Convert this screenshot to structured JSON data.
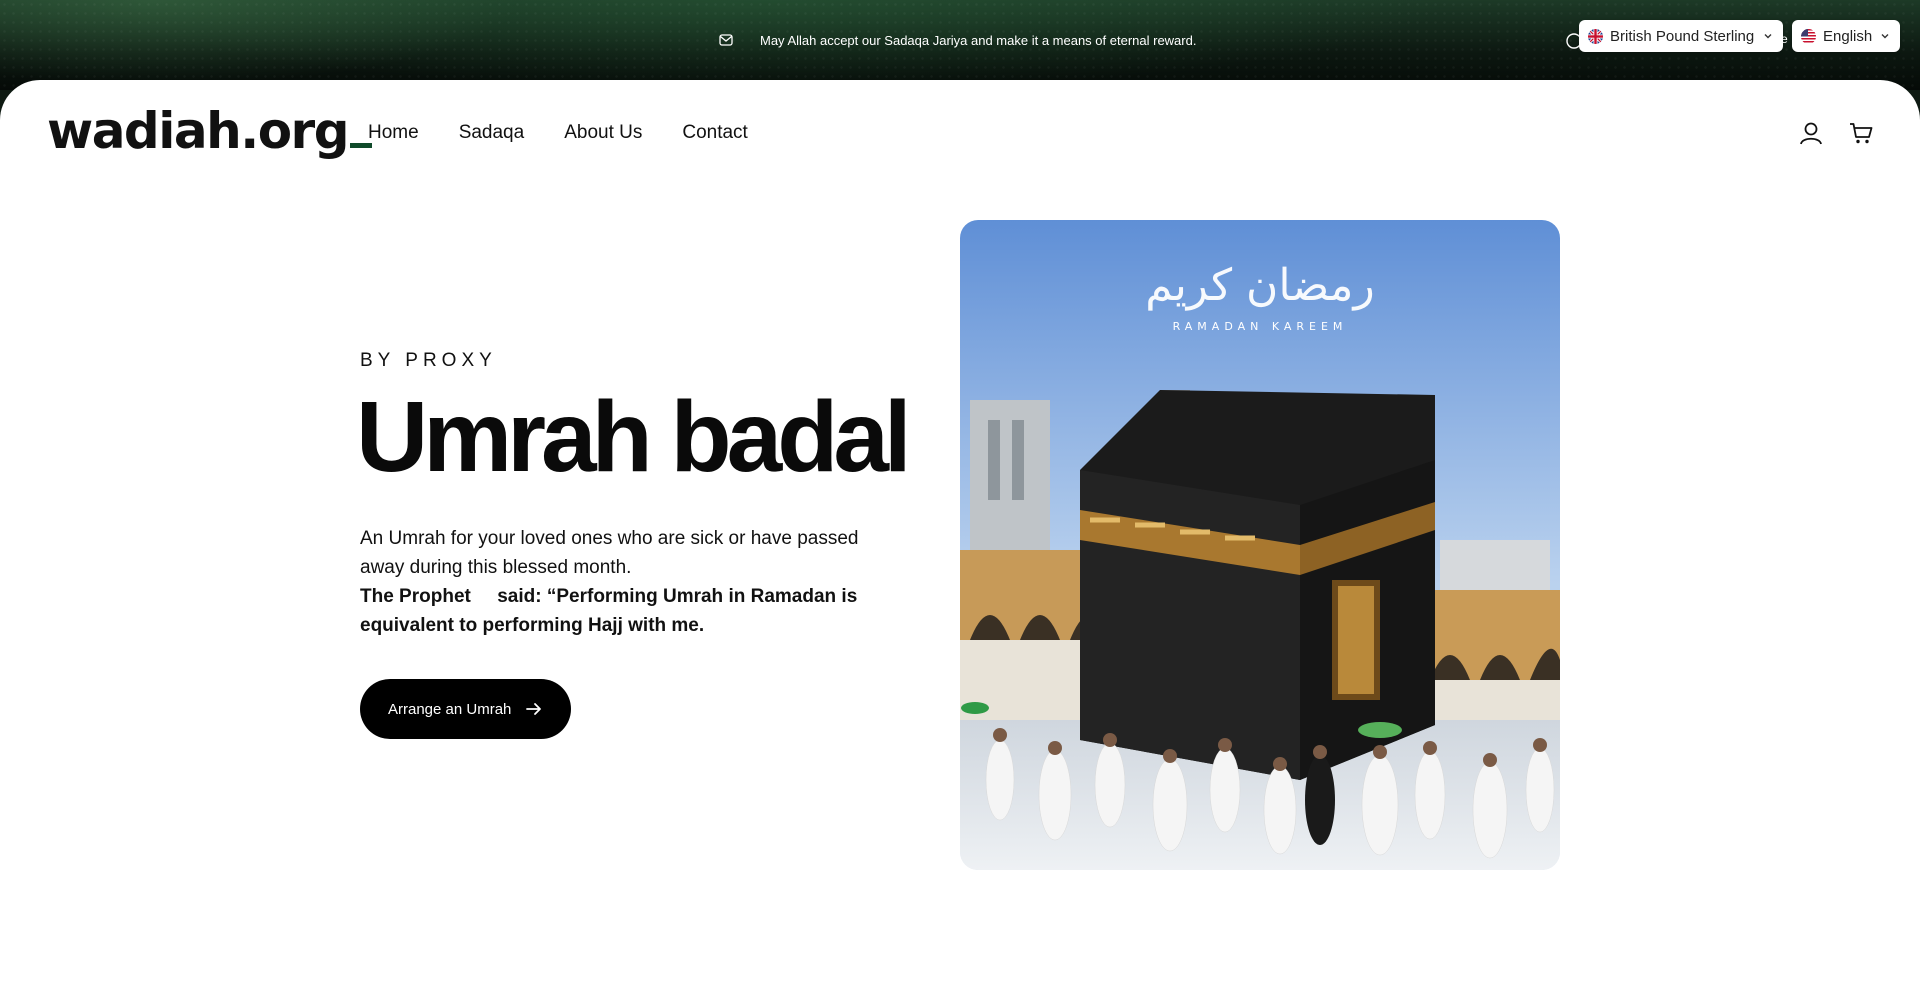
{
  "topbar": {
    "announcement": "May Allah accept our Sadaqa Jariya and make it a means of eternal reward.",
    "currency": {
      "selected": "British Pound Sterling"
    },
    "language": {
      "selected": "English",
      "peek": "e"
    }
  },
  "header": {
    "logo": "wadiah.org",
    "nav": [
      {
        "label": "Home"
      },
      {
        "label": "Sadaqa"
      },
      {
        "label": "About Us"
      },
      {
        "label": "Contact"
      }
    ]
  },
  "hero": {
    "eyebrow": "BY PROXY",
    "title": "Umrah badal",
    "description": "An Umrah for your loved ones who are sick or have passed away during this blessed month.",
    "quote": "The Prophet     said: “Performing Umrah in Ramadan is equivalent to performing Hajj with me.",
    "cta_label": "Arrange an Umrah",
    "image_caption": "RAMADAN KAREEM"
  },
  "colors": {
    "brand_green": "#0f4a2a",
    "topbar_dark": "#0c1710",
    "button_black": "#000000"
  },
  "icons": [
    "mail-icon",
    "chevron-down-icon",
    "uk-flag-icon",
    "us-flag-icon",
    "account-icon",
    "cart-icon",
    "arrow-right-icon"
  ]
}
